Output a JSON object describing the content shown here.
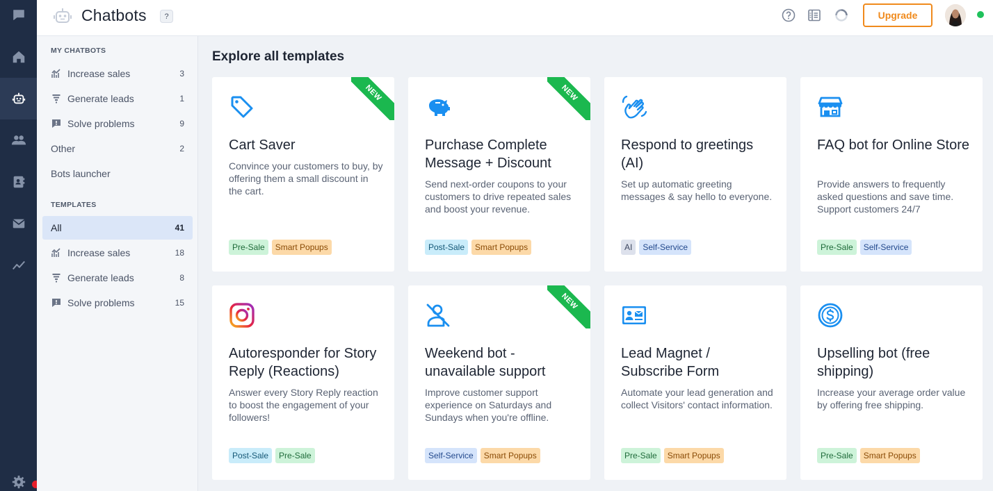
{
  "header": {
    "title": "Chatbots",
    "help_badge": "?",
    "upgrade_label": "Upgrade",
    "icons": [
      "help-circle-icon",
      "book-icon",
      "loading-icon"
    ]
  },
  "sidebar": {
    "my_chatbots_title": "MY CHATBOTS",
    "my_chatbots": [
      {
        "label": "Increase sales",
        "count": "3",
        "icon": "chart-icon"
      },
      {
        "label": "Generate leads",
        "count": "1",
        "icon": "funnel-icon"
      },
      {
        "label": "Solve problems",
        "count": "9",
        "icon": "alert-message-icon"
      },
      {
        "label": "Other",
        "count": "2",
        "icon": ""
      },
      {
        "label": "Bots launcher",
        "count": "",
        "icon": ""
      }
    ],
    "templates_title": "TEMPLATES",
    "templates": [
      {
        "label": "All",
        "count": "41",
        "active": true
      },
      {
        "label": "Increase sales",
        "count": "18",
        "icon": "chart-icon"
      },
      {
        "label": "Generate leads",
        "count": "8",
        "icon": "funnel-icon"
      },
      {
        "label": "Solve problems",
        "count": "15",
        "icon": "alert-message-icon"
      }
    ]
  },
  "main": {
    "title": "Explore all templates",
    "cards": [
      {
        "title": "Cart Saver",
        "desc": "Convince your customers to buy, by offering them a small discount in the cart.",
        "tags": [
          "Pre-Sale",
          "Smart Popups"
        ],
        "new": "NEW",
        "icon": "price-tag-icon"
      },
      {
        "title": "Purchase Complete Message + Discount",
        "desc": "Send next-order coupons to your customers to drive repeated sales and boost your revenue.",
        "tags": [
          "Post-Sale",
          "Smart Popups"
        ],
        "new": "NEW",
        "icon": "piggy-bank-icon"
      },
      {
        "title": "Respond to greetings (AI)",
        "desc": "Set up automatic greeting messages & say hello to everyone.",
        "tags": [
          "AI",
          "Self-Service"
        ],
        "new": "",
        "icon": "waving-hand-icon"
      },
      {
        "title": "FAQ bot for Online Store",
        "desc": "Provide answers to frequently asked questions and save time. Support customers 24/7",
        "tags": [
          "Pre-Sale",
          "Self-Service"
        ],
        "new": "",
        "icon": "store-icon"
      },
      {
        "title": "Autoresponder for Story Reply (Reactions)",
        "desc": "Answer every Story Reply reaction to boost the engagement of your followers!",
        "tags": [
          "Post-Sale",
          "Pre-Sale"
        ],
        "new": "",
        "icon": "instagram-icon"
      },
      {
        "title": "Weekend bot - unavailable support",
        "desc": "Improve customer support experience on Saturdays and Sundays when you're offline.",
        "tags": [
          "Self-Service",
          "Smart Popups"
        ],
        "new": "NEW",
        "icon": "user-off-icon"
      },
      {
        "title": "Lead Magnet / Subscribe Form",
        "desc": "Automate your lead generation and collect Visitors' contact information.",
        "tags": [
          "Pre-Sale",
          "Smart Popups"
        ],
        "new": "",
        "icon": "contact-card-icon"
      },
      {
        "title": "Upselling bot (free shipping)",
        "desc": "Increase your average order value by offering free shipping.",
        "tags": [
          "Pre-Sale",
          "Smart Popups"
        ],
        "new": "",
        "icon": "dollar-coin-icon"
      }
    ]
  },
  "colors": {
    "rail": "#1f2d45",
    "accent_blue": "#1a8ff0",
    "upgrade_orange": "#f08a1c",
    "new_green": "#1bb84f"
  }
}
